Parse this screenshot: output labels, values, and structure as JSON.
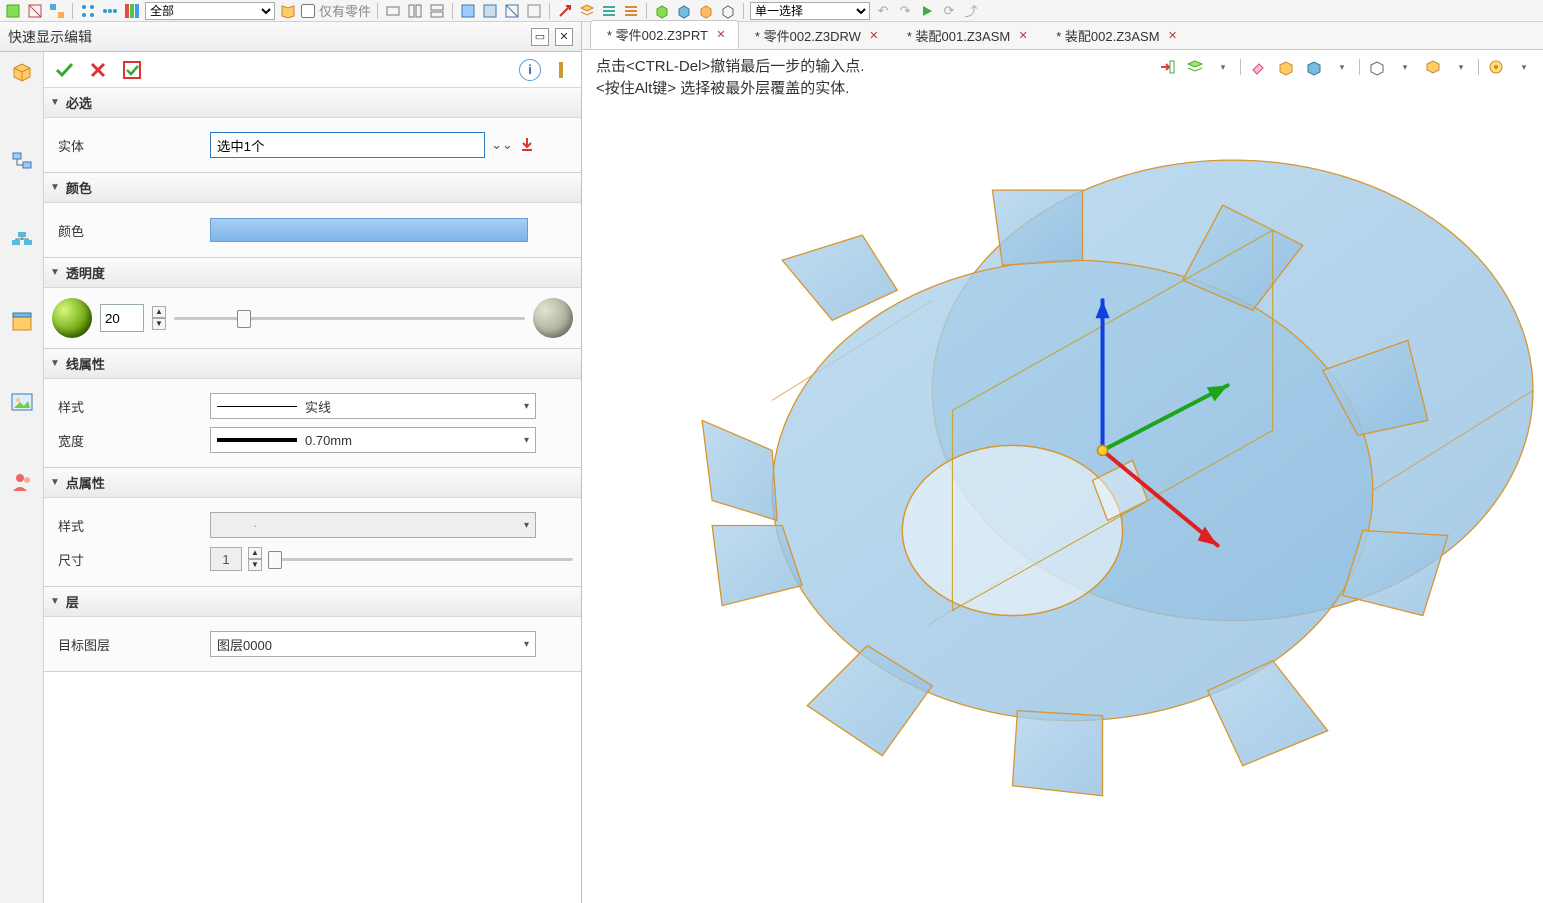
{
  "topbar": {
    "filter1": "全部",
    "only_parts_label": "仅有零件",
    "filter2": "单一选择"
  },
  "panel": {
    "title": "快速显示编辑"
  },
  "sections": {
    "required": {
      "title": "必选",
      "entity_label": "实体",
      "entity_value": "选中1个"
    },
    "color": {
      "title": "颜色",
      "color_label": "颜色"
    },
    "transparency": {
      "title": "透明度",
      "value": "20"
    },
    "line": {
      "title": "线属性",
      "style_label": "样式",
      "style_value": "实线",
      "width_label": "宽度",
      "width_value": "0.70mm"
    },
    "point": {
      "title": "点属性",
      "style_label": "样式",
      "style_value": "·",
      "size_label": "尺寸",
      "size_value": "1"
    },
    "layer": {
      "title": "层",
      "target_label": "目标图层",
      "target_value": "图层0000"
    }
  },
  "tabs": [
    {
      "name": "* 零件002.Z3PRT",
      "active": true
    },
    {
      "name": "* 零件002.Z3DRW",
      "active": false
    },
    {
      "name": "* 装配001.Z3ASM",
      "active": false
    },
    {
      "name": "* 装配002.Z3ASM",
      "active": false
    }
  ],
  "hint": {
    "line1": "点击<CTRL-Del>撤销最后一步的输入点.",
    "line2": "<按住Alt键> 选择被最外层覆盖的实体."
  }
}
